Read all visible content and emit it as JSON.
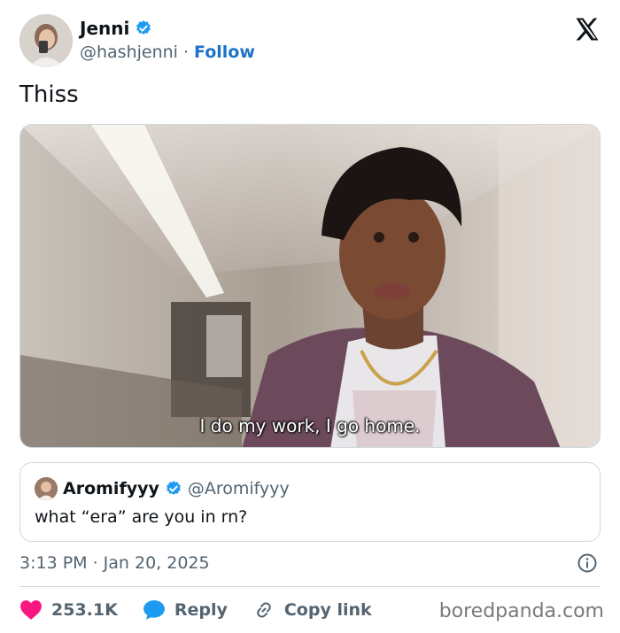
{
  "author": {
    "name": "Jenni",
    "handle": "@hashjenni",
    "follow_label": "Follow",
    "verified": true
  },
  "tweet": {
    "text": "Thiss",
    "media_subtitle": "I do my work, I go home."
  },
  "quoted": {
    "name": "Aromifyyy",
    "handle": "@Aromifyyy",
    "text": "what  “era” are you in rn?"
  },
  "meta": {
    "timestamp": "3:13 PM · Jan 20, 2025"
  },
  "actions": {
    "likes": "253.1K",
    "reply_label": "Reply",
    "copy_label": "Copy link"
  },
  "watermark": "boredpanda.com",
  "colors": {
    "like": "#f91880",
    "reply": "#1d9bf0",
    "verified": "#1d9bf0",
    "follow": "#1d73c7",
    "muted": "#536471"
  }
}
